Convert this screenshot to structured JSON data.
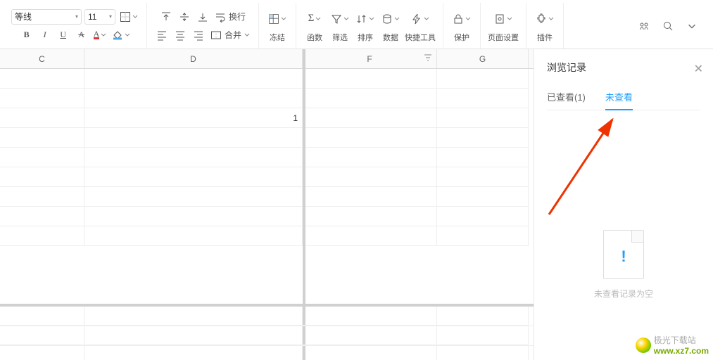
{
  "toolbar": {
    "font_name": "等线",
    "font_size": "11",
    "bold": "B",
    "italic": "I",
    "underline": "U",
    "strike": "A",
    "wrap_label": "换行",
    "merge_label": "合并",
    "groups": {
      "freeze": "冻结",
      "func": "函数",
      "filter": "筛选",
      "sort": "排序",
      "data": "数据",
      "quick": "快捷工具",
      "protect": "保护",
      "page": "页面设置",
      "plugin": "插件"
    }
  },
  "sheet": {
    "cols": {
      "c": "C",
      "d": "D",
      "f": "F",
      "g": "G"
    },
    "d3_value": "1"
  },
  "panel": {
    "title": "浏览记录",
    "tab_viewed": "已查看(1)",
    "tab_unviewed": "未查看",
    "empty_caption": "未查看记录为空"
  },
  "watermark": {
    "site": "极光下载站",
    "url": "www.xz7.com"
  }
}
